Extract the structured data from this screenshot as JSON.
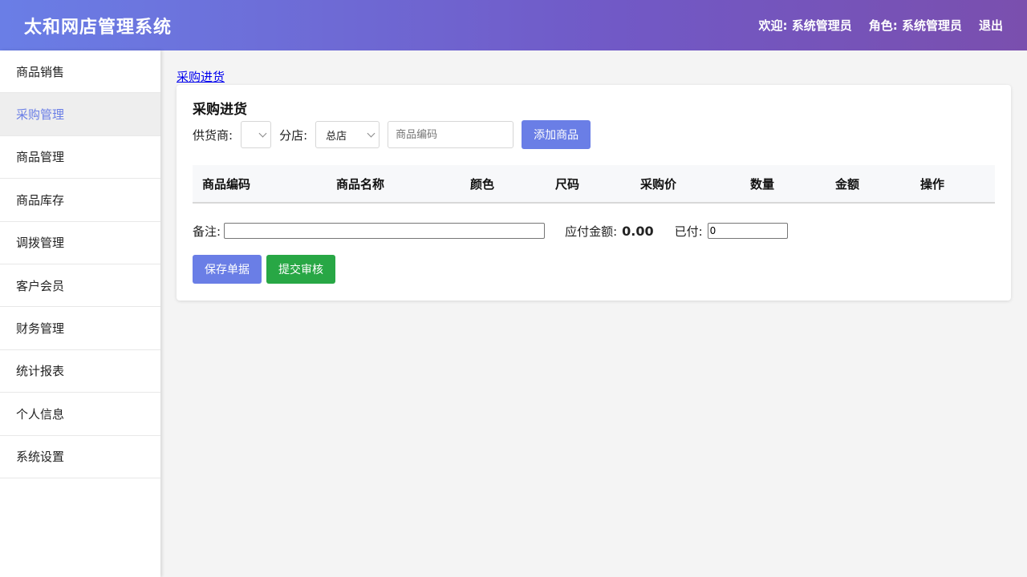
{
  "header": {
    "title": "太和网店管理系统",
    "welcome": "欢迎: 系统管理员",
    "role": "角色: 系统管理员",
    "logout": "退出",
    "gradient_start": "#6a7ee6",
    "gradient_end": "#7a4fae"
  },
  "sidebar": {
    "active_color": "#6a7ee6",
    "items": [
      {
        "label": "商品销售"
      },
      {
        "label": "采购管理"
      },
      {
        "label": "商品管理"
      },
      {
        "label": "商品库存"
      },
      {
        "label": "调拨管理"
      },
      {
        "label": "客户会员"
      },
      {
        "label": "财务管理"
      },
      {
        "label": "统计报表"
      },
      {
        "label": "个人信息"
      },
      {
        "label": "系统设置"
      }
    ]
  },
  "breadcrumb": "采购进货",
  "form": {
    "title": "采购进货",
    "supplier_label": "供货商:",
    "supplier_value": "",
    "branch_label": "分店:",
    "branch_value": "总店",
    "code_placeholder": "商品编码",
    "add_button": "添加商品"
  },
  "table": {
    "headers": [
      "商品编码",
      "商品名称",
      "颜色",
      "尺码",
      "采购价",
      "数量",
      "金额",
      "操作"
    ],
    "rows": []
  },
  "footer": {
    "remark_label": "备注:",
    "remark_value": "",
    "payable_label": "应付金额:",
    "payable_value": "0.00",
    "paid_label": "已付:",
    "paid_value": "0",
    "save_button": "保存单据",
    "submit_button": "提交审核"
  }
}
